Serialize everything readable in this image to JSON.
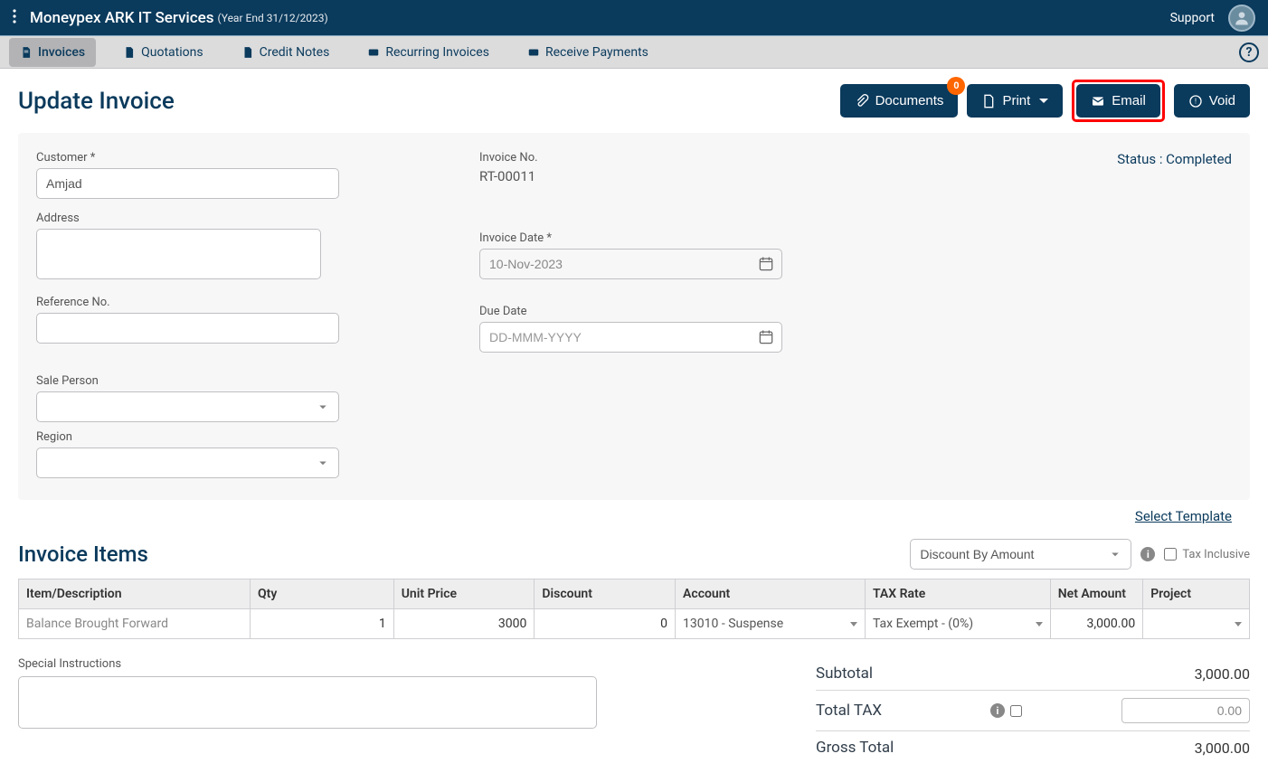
{
  "header": {
    "company": "Moneypex ARK IT Services",
    "year_info": "(Year End 31/12/2023)",
    "support": "Support"
  },
  "nav": {
    "invoices": "Invoices",
    "quotations": "Quotations",
    "credit_notes": "Credit Notes",
    "recurring": "Recurring Invoices",
    "receive_payments": "Receive Payments"
  },
  "page": {
    "title": "Update Invoice",
    "documents_btn": "Documents",
    "documents_badge": "0",
    "print_btn": "Print",
    "email_btn": "Email",
    "void_btn": "Void",
    "status_label": "Status : Completed"
  },
  "form": {
    "customer_label": "Customer *",
    "customer_value": "Amjad",
    "address_label": "Address",
    "address_value": "",
    "reference_label": "Reference No.",
    "reference_value": "",
    "sale_person_label": "Sale Person",
    "region_label": "Region",
    "invoice_no_label": "Invoice No.",
    "invoice_no_value": "RT-00011",
    "invoice_date_label": "Invoice Date *",
    "invoice_date_value": "10-Nov-2023",
    "due_date_label": "Due Date",
    "due_date_placeholder": "DD-MMM-YYYY",
    "select_template": "Select Template"
  },
  "items": {
    "title": "Invoice Items",
    "discount_mode": "Discount By Amount",
    "tax_inclusive_label": "Tax Inclusive",
    "cols": {
      "item": "Item/Description",
      "qty": "Qty",
      "unit_price": "Unit Price",
      "discount": "Discount",
      "account": "Account",
      "tax_rate": "TAX Rate",
      "net_amount": "Net Amount",
      "project": "Project"
    },
    "row": {
      "item": "Balance Brought Forward",
      "qty": "1",
      "unit_price": "3000",
      "discount": "0",
      "account": "13010 - Suspense",
      "tax_rate": "Tax Exempt - (0%)",
      "net_amount": "3,000.00",
      "project": ""
    }
  },
  "bottom": {
    "special_instructions_label": "Special Instructions",
    "subtotal_label": "Subtotal",
    "subtotal_value": "3,000.00",
    "total_tax_label": "Total TAX",
    "total_tax_value": "0.00",
    "gross_total_label": "Gross Total",
    "gross_total_value": "3,000.00"
  }
}
